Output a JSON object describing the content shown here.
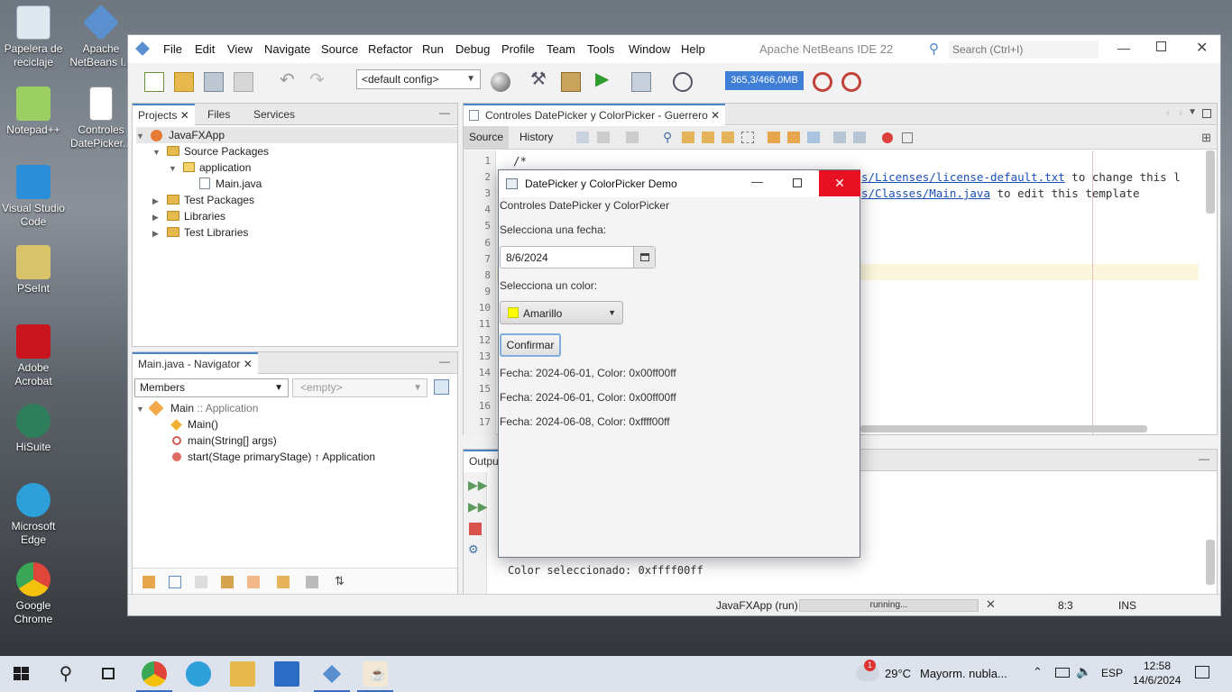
{
  "desktop": {
    "icons": [
      {
        "label": "Papelera de reciclaje",
        "color": "#dfe7ef"
      },
      {
        "label": "Apache NetBeans I...",
        "color": "#5a8fd0"
      },
      {
        "label": "Notepad++",
        "color": "#9ccf63"
      },
      {
        "label": "Controles DatePicker...",
        "color": "#ffffff"
      },
      {
        "label": "Visual Studio Code",
        "color": "#2c8ed8"
      },
      {
        "label": "PSeInt",
        "color": "#d8c36a"
      },
      {
        "label": "Adobe Acrobat",
        "color": "#c8141c"
      },
      {
        "label": "HiSuite",
        "color": "#2e7d5b"
      },
      {
        "label": "Microsoft Edge",
        "color": "#2d9fd9"
      },
      {
        "label": "Google Chrome",
        "color": "#e0453a"
      }
    ]
  },
  "netbeans": {
    "window_title": "Apache NetBeans IDE 22",
    "menu": [
      "File",
      "Edit",
      "View",
      "Navigate",
      "Source",
      "Refactor",
      "Run",
      "Debug",
      "Profile",
      "Team",
      "Tools",
      "Window",
      "Help"
    ],
    "search_placeholder": "Search (Ctrl+I)",
    "config_select": "<default config>",
    "memory": "365,3/466,0MB",
    "projects_panel": {
      "tabs": [
        "Projects",
        "Files",
        "Services"
      ],
      "tree": {
        "project": "JavaFXApp",
        "source_packages": "Source Packages",
        "package": "application",
        "file": "Main.java",
        "test_packages": "Test Packages",
        "libraries": "Libraries",
        "test_libraries": "Test Libraries"
      }
    },
    "navigator": {
      "tab": "Main.java - Navigator",
      "members_select": "Members",
      "empty_select": "<empty>",
      "class_name": "Main",
      "class_suffix": ":: Application",
      "items": [
        "Main()",
        "main(String[] args)",
        "start(Stage primaryStage) ↑ Application"
      ]
    },
    "editor": {
      "tab": "Controles DatePicker y ColorPicker - Guerrero",
      "subtabs": [
        "Source",
        "History"
      ],
      "line_numbers": [
        "1",
        "2",
        "3",
        "4",
        "5",
        "6",
        "7",
        "8",
        "9",
        "10",
        "11",
        "12",
        "13",
        "14",
        "15",
        "16",
        "17"
      ],
      "line1": "/*",
      "line2_link": "s/Licenses/license-default.txt",
      "line2_rest": " to change this l",
      "line3_link": "s/Classes/Main.java",
      "line3_rest": " to edit this template"
    },
    "output": {
      "tab": "Output",
      "last_line": "Color seleccionado: 0xffff00ff"
    },
    "status": {
      "task": "JavaFXApp (run)",
      "progress_text": "running...",
      "position": "8:3",
      "mode": "INS"
    }
  },
  "dialog": {
    "title": "DatePicker y ColorPicker Demo",
    "header": "Controles DatePicker y ColorPicker",
    "date_label": "Selecciona una fecha:",
    "date_value": "8/6/2024",
    "color_label": "Selecciona un color:",
    "color_value": "Amarillo",
    "color_swatch": "#ffff00",
    "confirm_button": "Confirmar",
    "results": [
      "Fecha: 2024-06-01, Color: 0x00ff00ff",
      "Fecha: 2024-06-01, Color: 0x00ff00ff",
      "Fecha: 2024-06-08, Color: 0xffff00ff"
    ]
  },
  "taskbar": {
    "weather_temp": "29°C",
    "weather_text": "Mayorm. nubla...",
    "weather_badge": "1",
    "language": "ESP",
    "time": "12:58",
    "date": "14/6/2024"
  },
  "colors": {
    "accent": "#4a86c7",
    "close_red": "#e81123",
    "memory_bg": "#3f7fd6"
  }
}
